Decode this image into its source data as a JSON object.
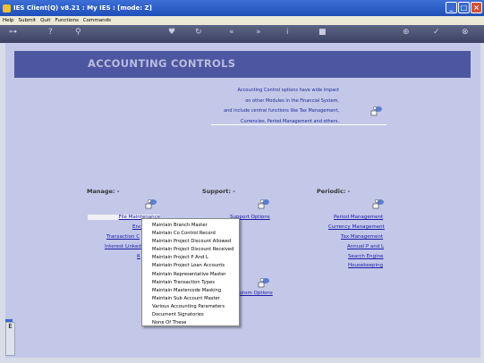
{
  "titlebar": {
    "title": "IES Client(Q) v8.21 : My IES :     [mode: Z]"
  },
  "menubar": {
    "items": [
      "Help",
      "Submit",
      "Quit",
      "Functions",
      "Commands"
    ]
  },
  "toolbar": {
    "icons": [
      "key-icon",
      "help-icon",
      "search-icon",
      "heart-icon",
      "refresh-icon",
      "back-icon",
      "forward-icon",
      "info-icon",
      "stop-icon",
      "add-icon",
      "ok-icon",
      "close-icon"
    ]
  },
  "banner": {
    "title": "ACCOUNTING CONTROLS"
  },
  "info": {
    "line1": "Accounting Control options have wide impact",
    "line2": "on other Modules in the Financial System,",
    "line3": "and include central functions like Tax Management,",
    "line4": "Currencies, Period Management and others."
  },
  "sections": {
    "manage": "Manage: -",
    "support": "Support: -",
    "periodic": "Periodic: -"
  },
  "manage_links": {
    "file_maintenance": "File Maintenance",
    "enc": "Enc",
    "transaction": "Transaction C",
    "interest": "Interest Linked",
    "r": "R"
  },
  "support_links": {
    "support_options": "Support Options",
    "custom_options": "stom Options"
  },
  "periodic_links": [
    "Period Management",
    "Currency Management",
    "Tax Management",
    "Annual P and L",
    "Search Engine",
    "Housekeeping"
  ],
  "popup_menu": [
    "Maintain Branch Master",
    "Maintain Co Control Record",
    "Maintain Project Discount Allowed",
    "Maintain Project Discount Received",
    "Maintain Project P And L",
    "Maintain Project Loan Accounts",
    "Maintain Representative Master",
    "Maintain Transaction Types",
    "Maintain Mastercode Masking",
    "Maintain Sub Account Master",
    "Various Accounting Parameters",
    "Document Signatories",
    "None Of These"
  ],
  "sidetab": {
    "label": "E"
  },
  "colors": {
    "title_blue": "#1f4fb8",
    "banner": "#4d56a0",
    "background": "#c3c8e8",
    "link": "#1a1aa8"
  }
}
